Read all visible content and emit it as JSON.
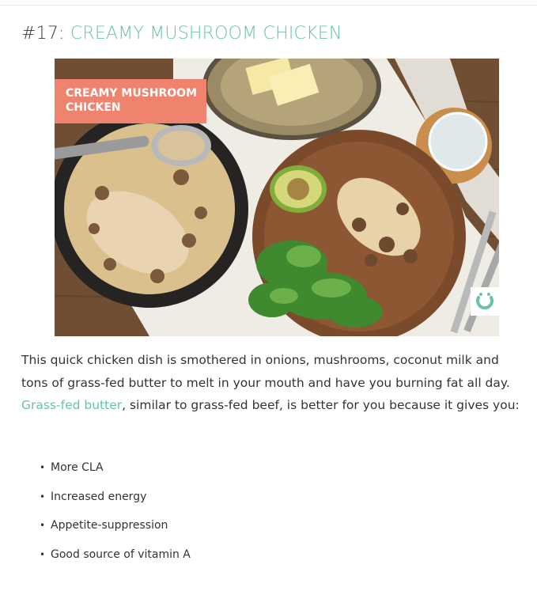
{
  "article": {
    "number": "#17:",
    "title": "CREAMY MUSHROOM CHICKEN",
    "image": {
      "overlay_line1": "CREAMY MUSHROOM",
      "overlay_line2": "CHICKEN",
      "badge_icon": "brand-logo-icon"
    },
    "intro": {
      "text_before_link": "This quick chicken dish is smothered in onions, mushrooms, coconut milk and tons of grass-fed butter to melt in your mouth and have you burning fat all day. ",
      "link_text": "Grass-fed butter",
      "text_after_link": ", similar to grass-fed beef, is better for you because it gives you:"
    },
    "benefits": [
      "More CLA",
      "Increased energy",
      "Appetite-suppression",
      "Good source of vitamin A"
    ],
    "colors": {
      "accent": "#67c4a7",
      "overlay": "#f0836e"
    }
  }
}
